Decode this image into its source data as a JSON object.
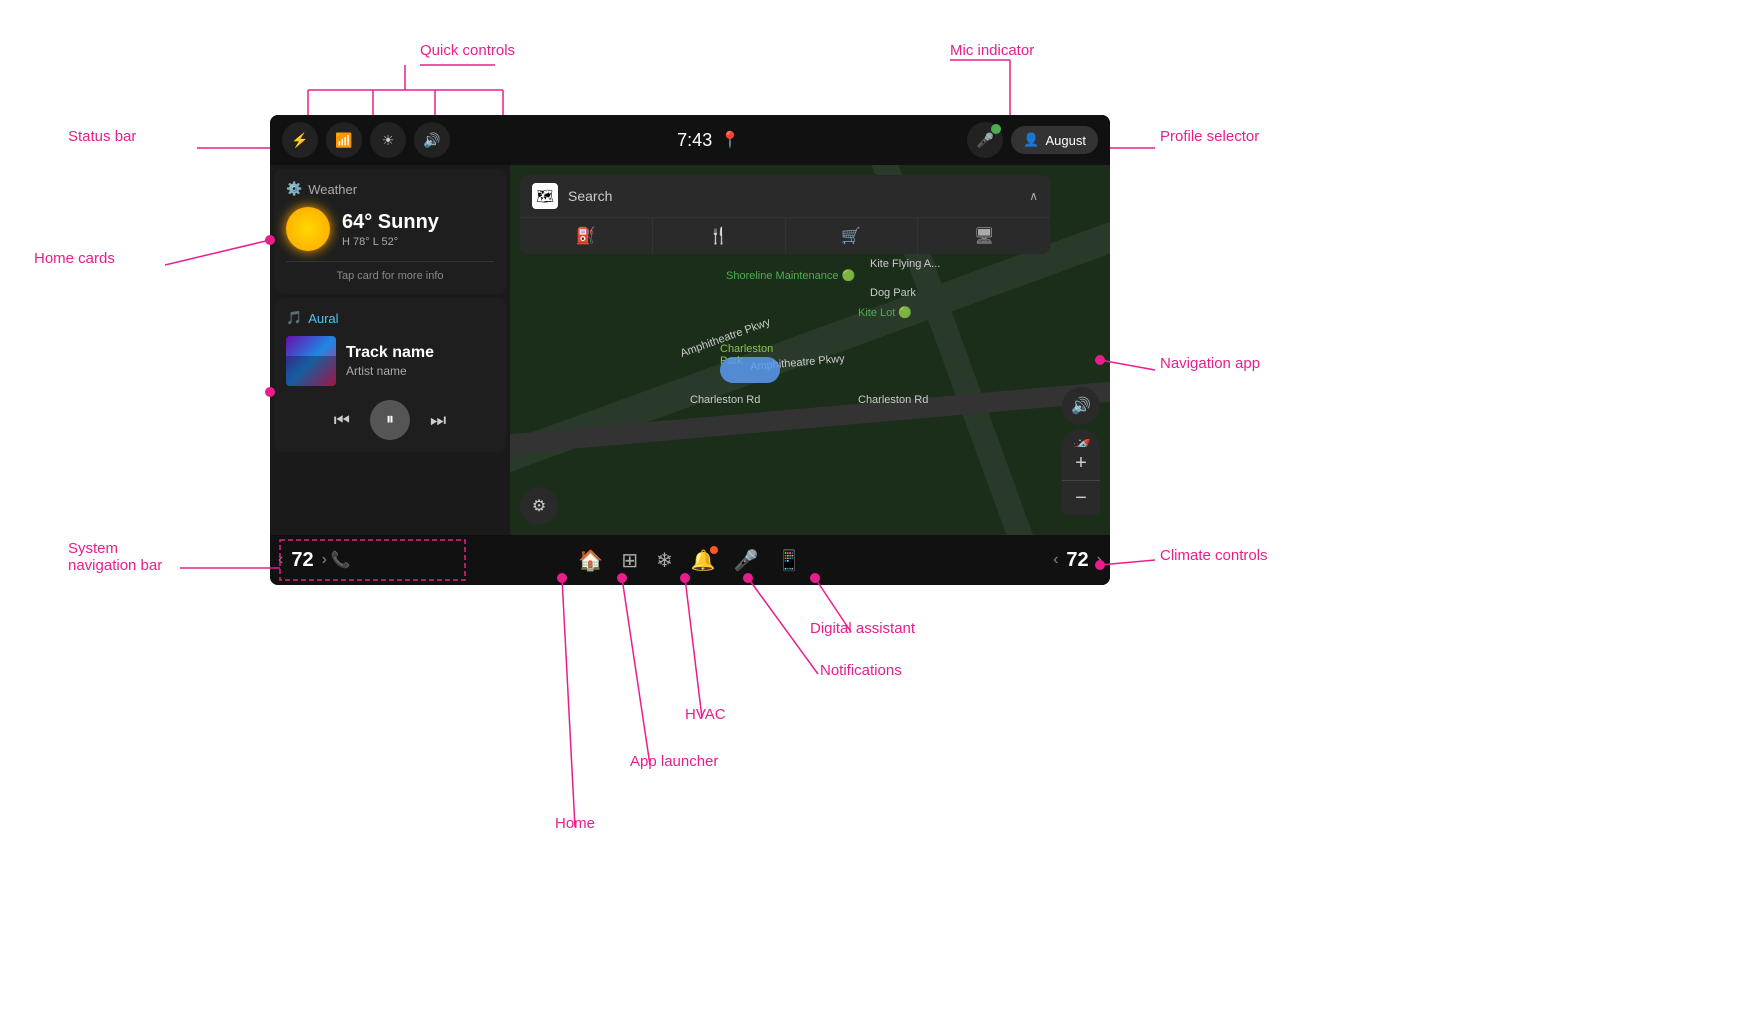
{
  "labels": {
    "quick_controls": "Quick controls",
    "mic_indicator": "Mic indicator",
    "status_bar": "Status bar",
    "profile_selector": "Profile selector",
    "home_cards": "Home cards",
    "navigation_app": "Navigation app",
    "system_nav_bar": "System\nnavigation bar",
    "climate_controls": "Climate controls",
    "digital_assistant": "Digital assistant",
    "notifications": "Notifications",
    "hvac": "HVAC",
    "app_launcher": "App launcher",
    "home": "Home"
  },
  "status_bar": {
    "time": "7:43",
    "profile_name": "August",
    "icons": [
      "bluetooth",
      "signal",
      "brightness",
      "volume"
    ]
  },
  "weather": {
    "app_name": "Weather",
    "temperature": "64° Sunny",
    "details": "H 78° L 52°",
    "tap_info": "Tap card for more info"
  },
  "music": {
    "app_name": "Aural",
    "track_name": "Track name",
    "artist_name": "Artist name"
  },
  "map": {
    "search_placeholder": "Search"
  },
  "climate": {
    "temp_left": "72",
    "temp_right": "72"
  }
}
